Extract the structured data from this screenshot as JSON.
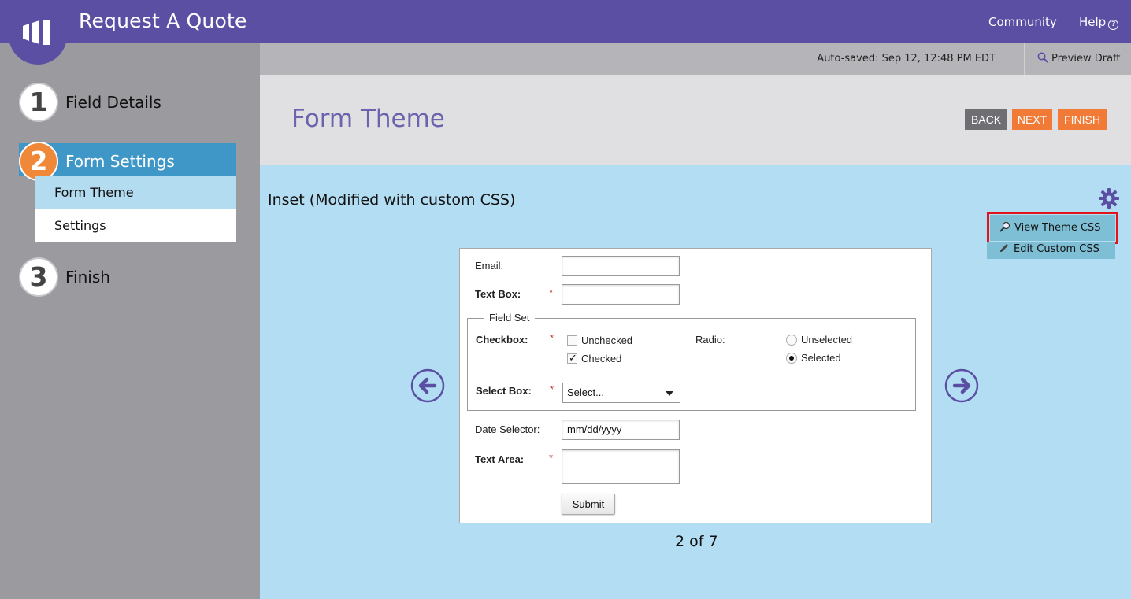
{
  "header": {
    "app_title": "Request A Quote",
    "community_label": "Community",
    "help_label": "Help",
    "help_icon_glyph": "?",
    "brand_color": "#5b4fa3"
  },
  "steps": [
    {
      "number": "1",
      "label": "Field Details"
    },
    {
      "number": "2",
      "label": "Form Settings",
      "active": true,
      "sub_items": [
        {
          "label": "Form Theme",
          "selected": true
        },
        {
          "label": "Settings"
        }
      ]
    },
    {
      "number": "3",
      "label": "Finish"
    }
  ],
  "savebar": {
    "autosaved_text": "Auto-saved: Sep 12, 12:48 PM EDT",
    "preview_label": "Preview Draft"
  },
  "title_area": {
    "page_title": "Form Theme",
    "back_label": "BACK",
    "next_label": "NEXT",
    "finish_label": "FINISH"
  },
  "theme": {
    "name": "Inset (Modified with custom CSS)",
    "menu": {
      "view_css_label": "View Theme CSS",
      "edit_css_label": "Edit Custom CSS"
    },
    "pager": "2 of 7"
  },
  "form_preview": {
    "email_label": "Email:",
    "textbox_label": "Text Box:",
    "required_mark": "*",
    "fieldset_legend": "Field Set",
    "checkbox_label": "Checkbox:",
    "checkbox_unchecked": "Unchecked",
    "checkbox_checked": "Checked",
    "check_glyph": "✓",
    "radio_label": "Radio:",
    "radio_unselected": "Unselected",
    "radio_selected": "Selected",
    "selectbox_label": "Select Box:",
    "select_value": "Select...",
    "date_label": "Date Selector:",
    "date_value": "mm/dd/yyyy",
    "textarea_label": "Text Area:",
    "submit_label": "Submit"
  },
  "icons": {
    "logo": "marketo-bars-logo",
    "preview": "magnifier-icon",
    "gear": "gear-icon",
    "view_css": "magnifier-icon",
    "edit_css": "pencil-icon",
    "prev": "arrow-left-circle-icon",
    "next": "arrow-right-circle-icon"
  }
}
